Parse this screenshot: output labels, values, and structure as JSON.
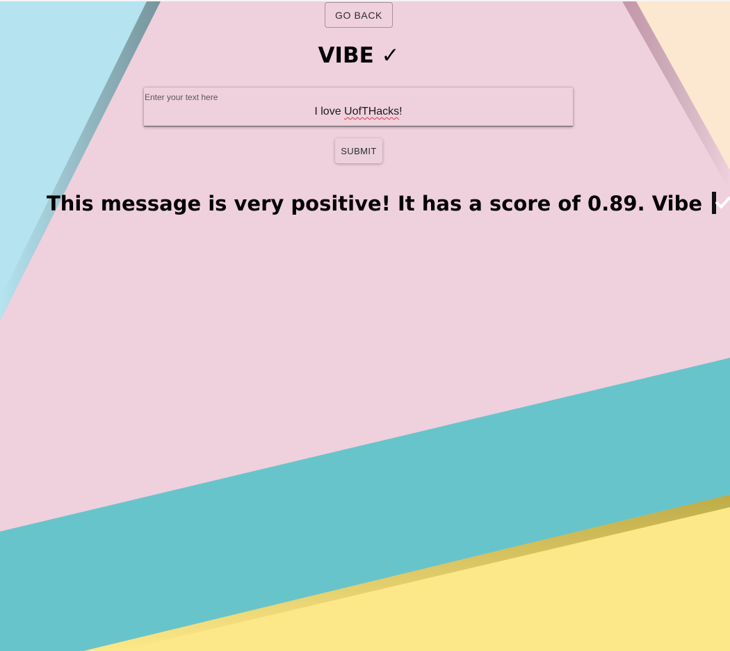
{
  "nav": {
    "go_back_label": "GO BACK"
  },
  "header": {
    "title": "VIBE ✓"
  },
  "form": {
    "input_label": "Enter your text here",
    "input_value_prefix": "I love ",
    "input_value_misspelled": "UofTHacks",
    "input_value_suffix": "!",
    "submit_label": "SUBMIT"
  },
  "result": {
    "message": "This message is very positive! It has a score of 0.89. Vibe",
    "icon": "check-mark-button-icon"
  },
  "colors": {
    "background_pink": "#efd0dd",
    "light_blue": "#b5e3ef",
    "teal": "#68c4cb",
    "yellow": "#fde889",
    "peach": "#fce7d0",
    "check_green": "#2ec41d"
  }
}
